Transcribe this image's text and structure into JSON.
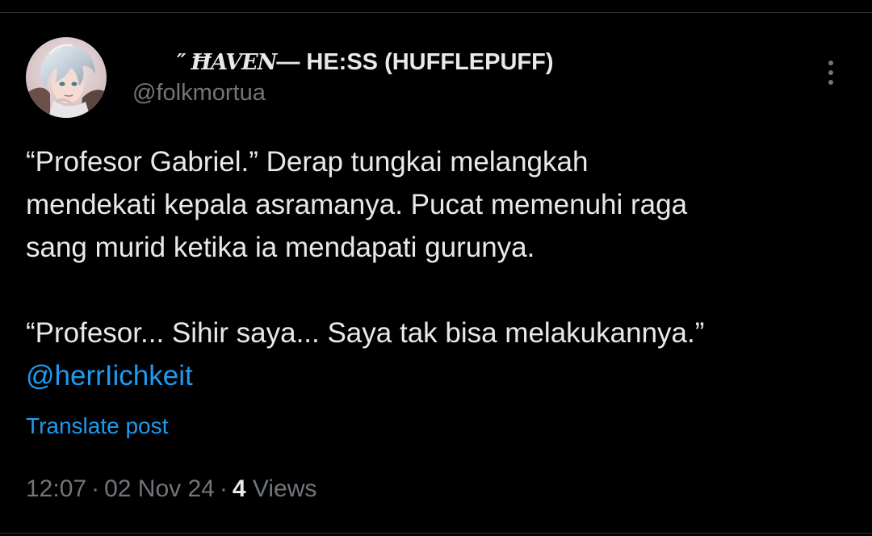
{
  "post": {
    "author": {
      "name_quote": "″",
      "name_haven": "ĦAVEN",
      "name_rest": " — HE:SS (HUFFLEPUFF)",
      "handle": "@folkmortua",
      "avatar_icon": "profile-avatar"
    },
    "more_icon": "more-vertical-icon",
    "text_lines": [
      "“Profesor Gabriel.” Derap tungkai melangkah",
      "mendekati kepala asramanya. Pucat memenuhi raga",
      "sang murid ketika ia mendapati gurunya.",
      "“Profesor... Sihir saya... Saya tak bisa melakukannya.”"
    ],
    "mention": "@herrIichkeit",
    "translate_label": "Translate post",
    "time": "12:07",
    "separator": "·",
    "date": "02 Nov 24",
    "views_count": "4",
    "views_label": "Views"
  },
  "colors": {
    "background": "#000000",
    "text_primary": "#e7e9ea",
    "text_secondary": "#71767b",
    "accent": "#1d9bf0",
    "divider": "#2f3336"
  }
}
